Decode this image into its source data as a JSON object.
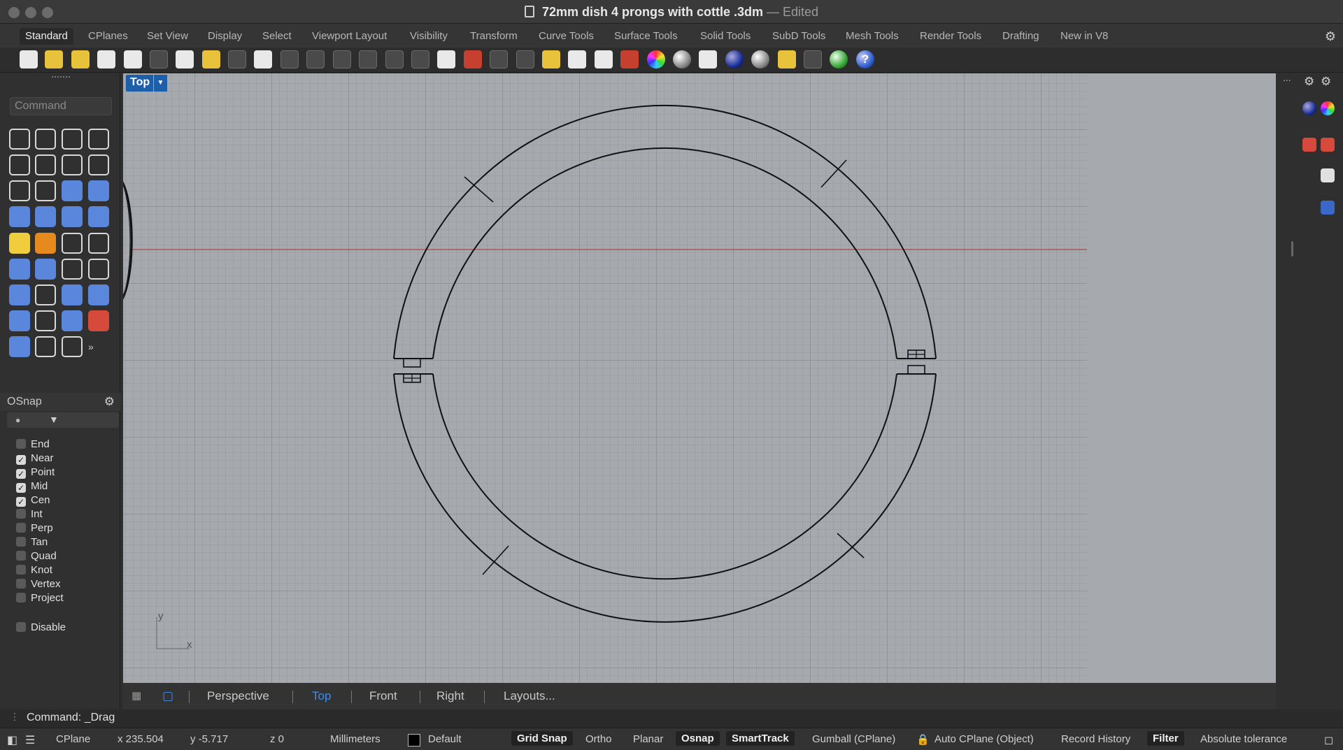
{
  "window": {
    "title": "72mm dish 4 prongs with cottle .3dm",
    "separator": "—",
    "state": "Edited"
  },
  "tabs": [
    {
      "label": "Standard",
      "active": true
    },
    {
      "label": "CPlanes"
    },
    {
      "label": "Set View"
    },
    {
      "label": "Display"
    },
    {
      "label": "Select"
    },
    {
      "label": "Viewport Layout"
    },
    {
      "label": "Visibility"
    },
    {
      "label": "Transform"
    },
    {
      "label": "Curve Tools"
    },
    {
      "label": "Surface Tools"
    },
    {
      "label": "Solid Tools"
    },
    {
      "label": "SubD Tools"
    },
    {
      "label": "Mesh Tools"
    },
    {
      "label": "Render Tools"
    },
    {
      "label": "Drafting"
    },
    {
      "label": "New in V8"
    }
  ],
  "toolbar_icons": [
    "new-file-icon",
    "open-folder-icon",
    "save-icon",
    "print-icon",
    "import-icon",
    "cut-icon",
    "copy-icon",
    "paste-icon",
    "undo-icon",
    "pan-hand-icon",
    "rotate-view-icon",
    "zoom-icon",
    "zoom-window-icon",
    "zoom-extents-icon",
    "zoom-selected-icon",
    "undo-view-icon",
    "four-viewports-icon",
    "car-icon",
    "grid-plane-icon",
    "cplane-icon",
    "points-icon",
    "light-icon",
    "lock-icon",
    "layer-icon",
    "color-wheel-icon",
    "display-sphere-icon",
    "render-mesh-icon",
    "render-sphere-icon",
    "material-icon",
    "settings-gear-icon",
    "dimension-icon",
    "world-icon",
    "help-icon"
  ],
  "left_panel": {
    "command_placeholder": "Command",
    "osnap": {
      "title": "OSnap",
      "items": [
        {
          "label": "End",
          "checked": false
        },
        {
          "label": "Near",
          "checked": true
        },
        {
          "label": "Point",
          "checked": true
        },
        {
          "label": "Mid",
          "checked": true
        },
        {
          "label": "Cen",
          "checked": true
        },
        {
          "label": "Int",
          "checked": false
        },
        {
          "label": "Perp",
          "checked": false
        },
        {
          "label": "Tan",
          "checked": false
        },
        {
          "label": "Quad",
          "checked": false
        },
        {
          "label": "Knot",
          "checked": false
        },
        {
          "label": "Vertex",
          "checked": false
        },
        {
          "label": "Project",
          "checked": false
        }
      ],
      "disable": {
        "label": "Disable",
        "checked": false
      }
    }
  },
  "viewport": {
    "name": "Top",
    "axis_y": "y",
    "axis_x": "x"
  },
  "viewport_tabs": [
    {
      "label": "Perspective"
    },
    {
      "label": "Top",
      "active": true
    },
    {
      "label": "Front"
    },
    {
      "label": "Right"
    },
    {
      "label": "Layouts..."
    }
  ],
  "command_line": "Command: _Drag",
  "status_bar": {
    "cplane": "CPlane",
    "x": "x 235.504",
    "y": "y -5.717",
    "z": "z 0",
    "units": "Millimeters",
    "layer": "Default",
    "grid_snap": "Grid Snap",
    "ortho": "Ortho",
    "planar": "Planar",
    "osnap": "Osnap",
    "smarttrack": "SmartTrack",
    "gumball": "Gumball (CPlane)",
    "auto_cplane": "Auto CPlane (Object)",
    "record_history": "Record History",
    "filter": "Filter",
    "tolerance": "Absolute tolerance"
  },
  "colors": {
    "viewport_bg": "#a6a9ae",
    "x_axis": "#b03030",
    "active_tab": "#3d8ef0",
    "viewport_label": "#1f5faa"
  }
}
